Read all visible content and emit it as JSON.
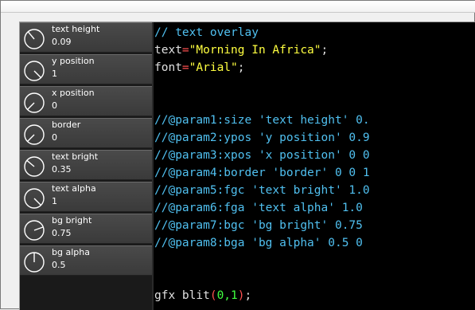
{
  "sliders": [
    {
      "label": "text height",
      "value": "0.09",
      "angle": -40
    },
    {
      "label": "y position",
      "value": "1",
      "angle": 135
    },
    {
      "label": "x position",
      "value": "0",
      "angle": -135
    },
    {
      "label": "border",
      "value": "0",
      "angle": -135
    },
    {
      "label": "text bright",
      "value": "0.35",
      "angle": -50
    },
    {
      "label": "text alpha",
      "value": "1",
      "angle": 135
    },
    {
      "label": "bg bright",
      "value": "0.75",
      "angle": 70
    },
    {
      "label": "bg alpha",
      "value": "0.5",
      "angle": 0
    }
  ],
  "code": {
    "line1": {
      "comment": "// text overlay"
    },
    "line2": {
      "ident": "text",
      "op": "=",
      "string": "\"Morning In Africa\"",
      "end": ";"
    },
    "line3": {
      "ident": "font",
      "op": "=",
      "string": "\"Arial\"",
      "end": ";"
    },
    "params": [
      "//@param1:size 'text height' 0.",
      "//@param2:ypos 'y position' 0.9",
      "//@param3:xpos 'x position' 0 0",
      "//@param4:border 'border' 0 0 1",
      "//@param5:fgc 'text bright' 1.0",
      "//@param6:fga 'text alpha' 1.0 ",
      "//@param7:bgc 'bg bright' 0.75 ",
      "//@param8:bga 'bg alpha' 0.5 0 "
    ],
    "last": {
      "ident": "gfx blit",
      "open": "(",
      "args": "0,1",
      "close": ")",
      "end": ";"
    }
  },
  "colors": {
    "comment": "#50c0f0",
    "string": "#ffff40",
    "operator": "#ff5050",
    "number": "#40ff40",
    "background": "#000000"
  }
}
